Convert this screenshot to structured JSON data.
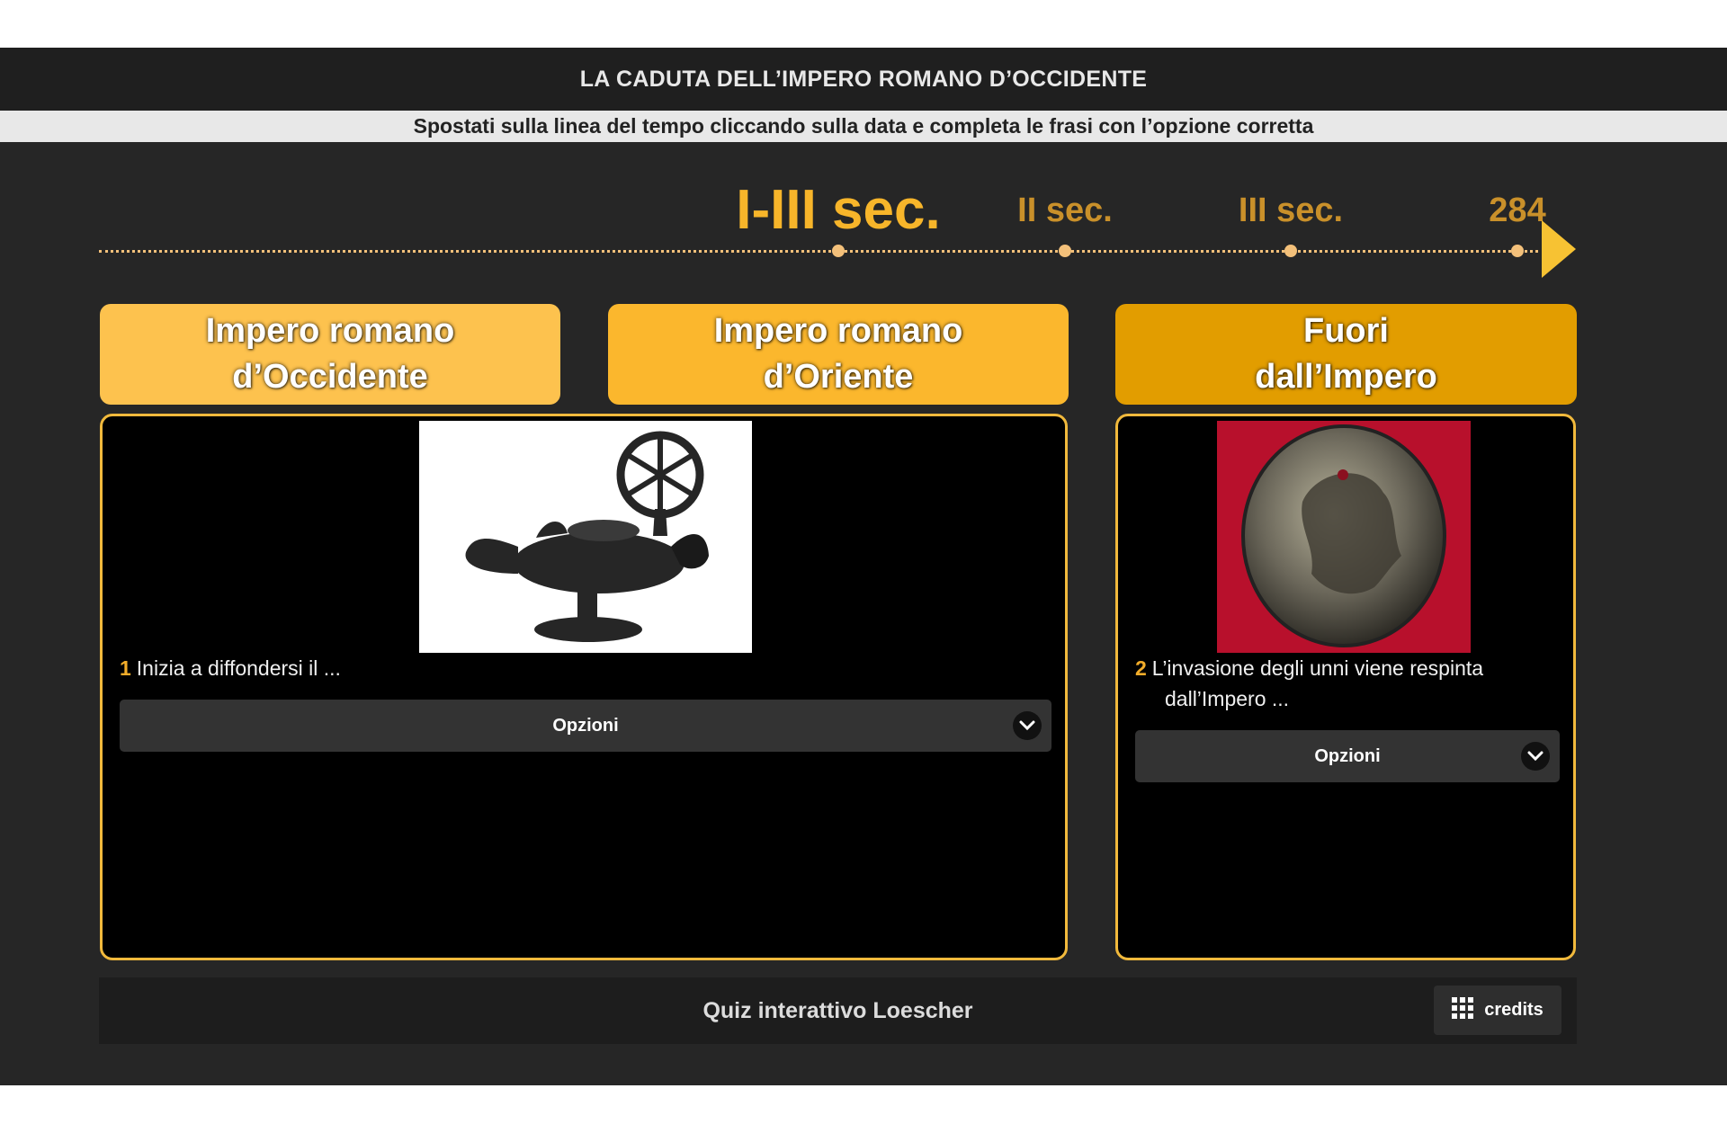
{
  "header": {
    "title": "LA CADUTA DELL’IMPERO ROMANO D’OCCIDENTE",
    "instruction": "Spostati sulla linea del tempo cliccando sulla data e completa le frasi con l’opzione corretta"
  },
  "timeline": {
    "active": "I-III sec.",
    "items": [
      "II sec.",
      "III sec.",
      "284"
    ],
    "colors": {
      "active": "#f7b52a",
      "inactive": "#c9902a",
      "line": "#f3c07a"
    }
  },
  "categories": [
    {
      "label": "Impero romano\nd’Occidente",
      "color": "#fdc24e"
    },
    {
      "label": "Impero romano\nd’Oriente",
      "color": "#fbb72d"
    },
    {
      "label": "Fuori\ndall’Impero",
      "color": "#e29d00"
    }
  ],
  "panels": [
    {
      "number": "1",
      "text": "Inizia a diffondersi il ...",
      "text_cont": "",
      "image": "oil-lamp-with-chi-rho-image",
      "select_label": "Opzioni"
    },
    {
      "number": "2",
      "text": "L’invasione degli unni viene respinta",
      "text_cont": "dall’Impero ...",
      "image": "attila-medallion-image",
      "select_label": "Opzioni"
    }
  ],
  "footer": {
    "text": "Quiz interattivo Loescher",
    "credits_label": "credits",
    "credits_icon": "grid-icon"
  }
}
